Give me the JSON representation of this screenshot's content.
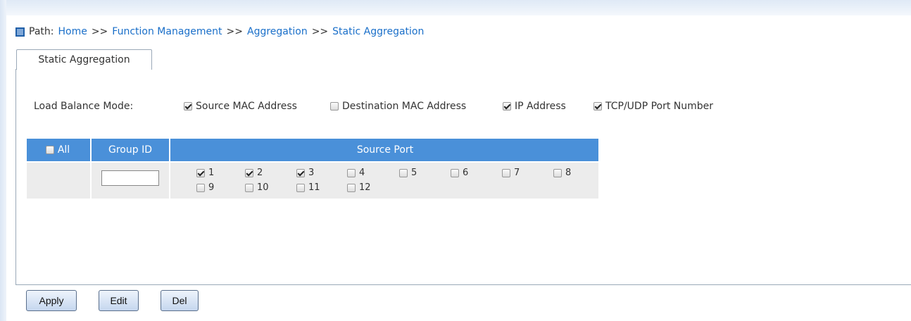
{
  "breadcrumb": {
    "label": "Path:",
    "items": [
      "Home",
      "Function Management",
      "Aggregation",
      "Static Aggregation"
    ],
    "separator": ">>"
  },
  "tabs": [
    {
      "label": "Static Aggregation"
    }
  ],
  "load_balance": {
    "label": "Load Balance Mode:",
    "options": [
      {
        "label": "Source MAC Address",
        "checked": true
      },
      {
        "label": "Destination MAC Address",
        "checked": false
      },
      {
        "label": "IP Address",
        "checked": true
      },
      {
        "label": "TCP/UDP Port Number",
        "checked": true
      }
    ]
  },
  "table": {
    "headers": {
      "all": "All",
      "group_id": "Group ID",
      "source_port": "Source Port"
    },
    "all_checked": false,
    "group_id_value": "",
    "ports": [
      {
        "label": "1",
        "checked": true
      },
      {
        "label": "2",
        "checked": true
      },
      {
        "label": "3",
        "checked": true
      },
      {
        "label": "4",
        "checked": false
      },
      {
        "label": "5",
        "checked": false
      },
      {
        "label": "6",
        "checked": false
      },
      {
        "label": "7",
        "checked": false
      },
      {
        "label": "8",
        "checked": false
      },
      {
        "label": "9",
        "checked": false
      },
      {
        "label": "10",
        "checked": false
      },
      {
        "label": "11",
        "checked": false
      },
      {
        "label": "12",
        "checked": false
      }
    ]
  },
  "buttons": {
    "apply": "Apply",
    "edit": "Edit",
    "del": "Del"
  },
  "colors": {
    "header_blue": "#4a90d9",
    "link_blue": "#1a6fc9",
    "row_gray": "#ececec"
  }
}
